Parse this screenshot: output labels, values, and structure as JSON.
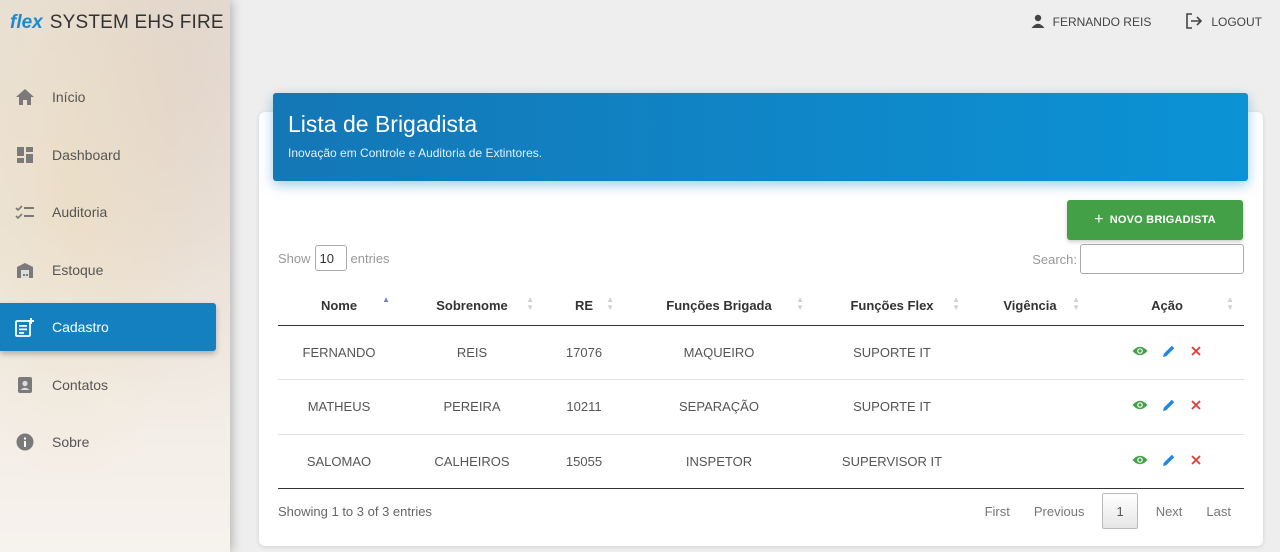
{
  "brand": {
    "logo": "flex",
    "name": "SYSTEM EHS FIRE"
  },
  "topbar": {
    "user": "FERNANDO REIS",
    "logout": "LOGOUT"
  },
  "sidebar": {
    "items": [
      {
        "label": "Início",
        "icon": "home-icon"
      },
      {
        "label": "Dashboard",
        "icon": "dashboard-icon"
      },
      {
        "label": "Auditoria",
        "icon": "checklist-icon"
      },
      {
        "label": "Estoque",
        "icon": "warehouse-icon"
      },
      {
        "label": "Cadastro",
        "icon": "register-icon",
        "active": true
      },
      {
        "label": "Contatos",
        "icon": "contacts-icon"
      },
      {
        "label": "Sobre",
        "icon": "info-icon"
      }
    ]
  },
  "card": {
    "title": "Lista de Brigadista",
    "subtitle": "Inovação em Controle e Auditoria de Extintores.",
    "new_button": "NOVO BRIGADISTA"
  },
  "table_controls": {
    "show_label": "Show",
    "entries_value": "10",
    "entries_label": "entries",
    "search_label": "Search:",
    "search_value": ""
  },
  "table": {
    "columns": [
      "Nome",
      "Sobrenome",
      "RE",
      "Funções Brigada",
      "Funções Flex",
      "Vigência",
      "Ação"
    ],
    "rows": [
      [
        "FERNANDO",
        "REIS",
        "17076",
        "MAQUEIRO",
        "SUPORTE IT",
        ""
      ],
      [
        "MATHEUS",
        "PEREIRA",
        "10211",
        "SEPARAÇÃO",
        "SUPORTE IT",
        ""
      ],
      [
        "SALOMAO",
        "CALHEIROS",
        "15055",
        "INSPETOR",
        "SUPERVISOR IT",
        ""
      ]
    ]
  },
  "footer": {
    "info": "Showing 1 to 3 of 3 entries",
    "first": "First",
    "previous": "Previous",
    "current_page": "1",
    "next": "Next",
    "last": "Last"
  },
  "colors": {
    "accent": "#1480c0",
    "success": "#43a047",
    "danger": "#e53935",
    "edit": "#1e88e5"
  }
}
